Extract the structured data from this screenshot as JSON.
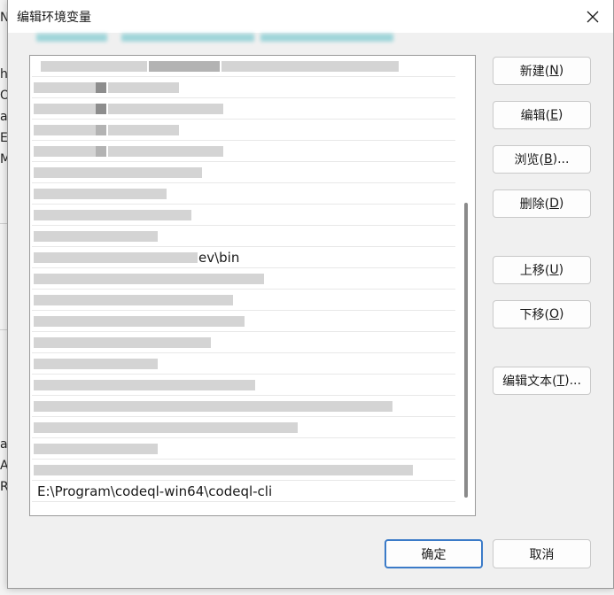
{
  "dialog": {
    "title": "编辑环境变量",
    "close_label": "close"
  },
  "background_window": {
    "edge_letters": [
      "N",
      "h",
      "O",
      "a",
      "E",
      "M",
      "a",
      "A",
      "R"
    ]
  },
  "list": {
    "visible_text_rows": [
      {
        "index": 9,
        "text": "ev\\bin"
      },
      {
        "index": 20,
        "text": "E:\\Program\\codeql-win64\\codeql-cli"
      }
    ]
  },
  "buttons": {
    "new": {
      "label": "新建(",
      "key": "N",
      "suffix": ")"
    },
    "edit": {
      "label": "编辑(",
      "key": "E",
      "suffix": ")"
    },
    "browse": {
      "label": "浏览(",
      "key": "B",
      "suffix": ")..."
    },
    "delete": {
      "label": "删除(",
      "key": "D",
      "suffix": ")"
    },
    "move_up": {
      "label": "上移(",
      "key": "U",
      "suffix": ")"
    },
    "move_down": {
      "label": "下移(",
      "key": "O",
      "suffix": ")"
    },
    "edit_text": {
      "label": "编辑文本(",
      "key": "T",
      "suffix": ")..."
    },
    "ok": "确定",
    "cancel": "取消"
  },
  "colors": {
    "accent": "#3b7bc8",
    "dialog_bg": "#f0f0f0",
    "list_bg": "#ffffff"
  }
}
